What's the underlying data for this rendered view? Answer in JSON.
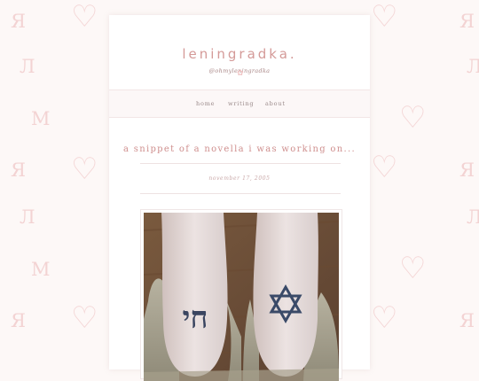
{
  "background": {
    "pattern": [
      "Я",
      "Л",
      "М",
      "♡"
    ],
    "letter_color": "#f3d3d3",
    "heart_color": "#f4d6d6"
  },
  "blog": {
    "title": "leningradka.",
    "handle": "@ohmyleningradka",
    "accent_color": "#d49a98"
  },
  "nav": {
    "items": [
      {
        "label": "home"
      },
      {
        "label": "writing"
      },
      {
        "label": "about"
      }
    ]
  },
  "post": {
    "title": "a snippet of a novella i was working on...",
    "date": "november 17, 2005",
    "image": {
      "icon_left": "hebrew-chai-tattoo",
      "icon_right": "star-of-david-tattoo",
      "left_glyph": "חי"
    }
  }
}
